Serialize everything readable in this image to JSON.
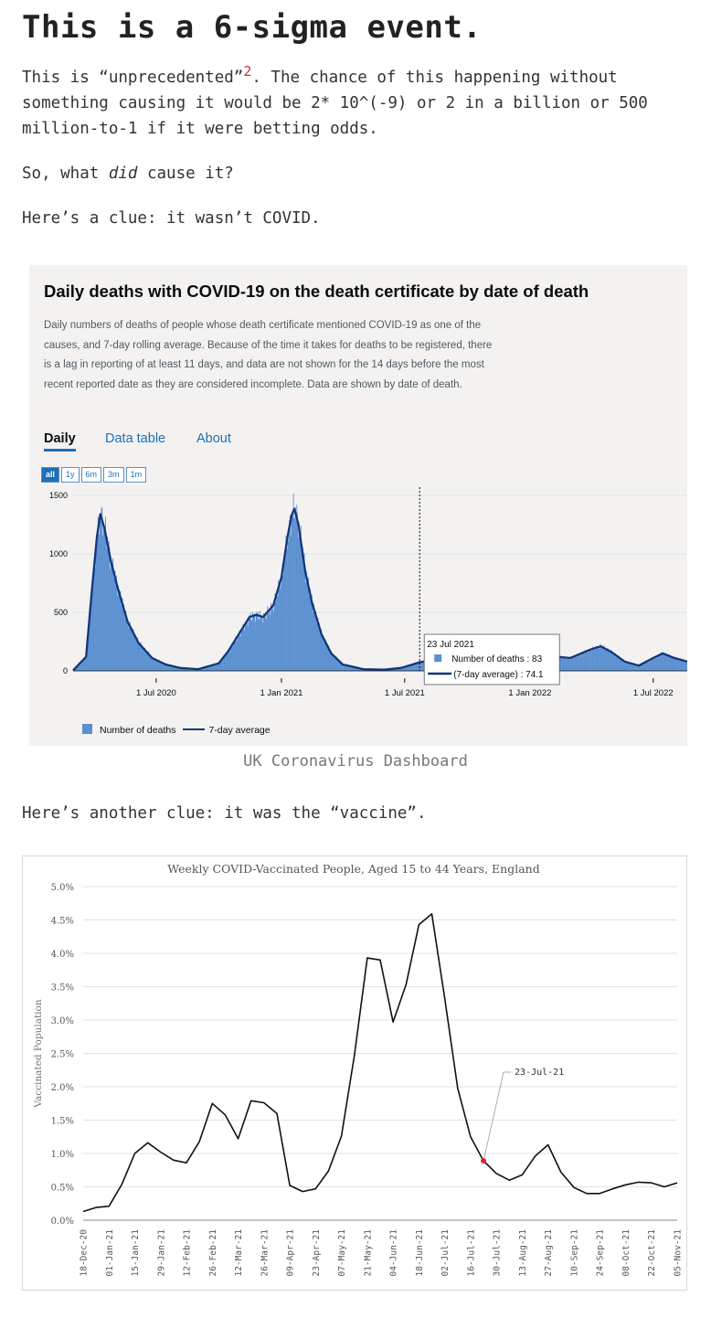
{
  "article": {
    "heading": "This is a 6-sigma event.",
    "p1_before": "This is “unprecedented”",
    "p1_footnote": "2",
    "p1_after": ". The chance of this happening without\nsomething causing it would be 2* 10^(-9) or 2 in a billion or 500\nmillion-to-1 if it were betting odds.",
    "p2_before": "So, what ",
    "p2_em": "did",
    "p2_after": " cause it?",
    "p3": "Here’s a clue: it wasn’t COVID.",
    "caption1": "UK Coronavirus Dashboard",
    "p4": "Here’s another clue: it was the “vaccine”."
  },
  "dashboard": {
    "title": "Daily deaths with COVID-19 on the death certificate by date of death",
    "description": "Daily numbers of deaths of people whose death certificate mentioned COVID-19 as one of the causes, and 7-day rolling average. Because of the time it takes for deaths to be registered, there is a lag in reporting of at least 11 days, and data are not shown for the 14 days before the most recent reported date as they are considered incomplete. Data are shown by date of death.",
    "tabs": [
      "Daily",
      "Data table",
      "About"
    ],
    "ranges": [
      "all",
      "1y",
      "6m",
      "3m",
      "1m"
    ],
    "legend": {
      "bars": "Number of deaths",
      "line": "7-day average"
    },
    "tooltip": {
      "date": "23 Jul 2021",
      "bars": "Number of deaths : 83",
      "line": "(7-day average) : 74.1"
    },
    "colors": {
      "bars": "#5a8fd0",
      "line": "#12367a",
      "tabs": "#1d70b8"
    }
  },
  "chart_data": [
    {
      "type": "bar",
      "title": "Daily deaths with COVID-19 on the death certificate by date of death",
      "x_range": [
        "2020-03-01",
        "2022-08-20"
      ],
      "xticks": [
        {
          "date": "2020-07-01",
          "label": "1 Jul 2020"
        },
        {
          "date": "2021-01-01",
          "label": "1 Jan 2021"
        },
        {
          "date": "2021-07-01",
          "label": "1 Jul 2021"
        },
        {
          "date": "2022-01-01",
          "label": "1 Jan 2022"
        },
        {
          "date": "2022-07-01",
          "label": "1 Jul 2022"
        }
      ],
      "yticks": [
        0,
        500,
        1000,
        1500
      ],
      "ylim": [
        0,
        1500
      ],
      "series": [
        {
          "name": "7-day average",
          "points": [
            [
              "2020-03-01",
              5
            ],
            [
              "2020-03-20",
              120
            ],
            [
              "2020-03-28",
              650
            ],
            [
              "2020-04-05",
              1150
            ],
            [
              "2020-04-10",
              1340
            ],
            [
              "2020-04-16",
              1220
            ],
            [
              "2020-04-25",
              950
            ],
            [
              "2020-05-05",
              720
            ],
            [
              "2020-05-20",
              420
            ],
            [
              "2020-06-05",
              240
            ],
            [
              "2020-06-25",
              110
            ],
            [
              "2020-07-15",
              55
            ],
            [
              "2020-08-05",
              25
            ],
            [
              "2020-09-01",
              15
            ],
            [
              "2020-10-01",
              65
            ],
            [
              "2020-10-15",
              170
            ],
            [
              "2020-11-01",
              330
            ],
            [
              "2020-11-15",
              460
            ],
            [
              "2020-11-25",
              480
            ],
            [
              "2020-12-05",
              460
            ],
            [
              "2020-12-20",
              560
            ],
            [
              "2021-01-01",
              800
            ],
            [
              "2021-01-10",
              1150
            ],
            [
              "2021-01-16",
              1330
            ],
            [
              "2021-01-20",
              1385
            ],
            [
              "2021-01-26",
              1250
            ],
            [
              "2021-02-05",
              850
            ],
            [
              "2021-02-15",
              580
            ],
            [
              "2021-03-01",
              310
            ],
            [
              "2021-03-15",
              150
            ],
            [
              "2021-04-01",
              55
            ],
            [
              "2021-05-01",
              15
            ],
            [
              "2021-06-01",
              10
            ],
            [
              "2021-06-25",
              25
            ],
            [
              "2021-07-10",
              50
            ],
            [
              "2021-07-23",
              74.1
            ],
            [
              "2021-08-10",
              90
            ],
            [
              "2021-09-01",
              100
            ],
            [
              "2021-10-01",
              110
            ],
            [
              "2021-11-01",
              125
            ],
            [
              "2021-11-20",
              110
            ],
            [
              "2021-12-10",
              95
            ],
            [
              "2022-01-01",
              145
            ],
            [
              "2022-01-15",
              180
            ],
            [
              "2022-02-01",
              125
            ],
            [
              "2022-03-01",
              110
            ],
            [
              "2022-04-01",
              185
            ],
            [
              "2022-04-15",
              210
            ],
            [
              "2022-05-01",
              160
            ],
            [
              "2022-05-20",
              80
            ],
            [
              "2022-06-10",
              45
            ],
            [
              "2022-07-01",
              110
            ],
            [
              "2022-07-15",
              150
            ],
            [
              "2022-08-01",
              110
            ],
            [
              "2022-08-20",
              80
            ]
          ]
        },
        {
          "name": "Number of deaths",
          "highlight": {
            "date": "2021-07-23",
            "value": 83
          }
        }
      ],
      "marker_date": "2021-07-23"
    },
    {
      "type": "line",
      "title": "Weekly COVID-Vaccinated People, Aged 15 to 44 Years, England",
      "ylabel": "Vaccinated Population",
      "xlabel": "",
      "ylim": [
        0,
        5
      ],
      "yticks": [
        "0.0%",
        "0.5%",
        "1.0%",
        "1.5%",
        "2.0%",
        "2.5%",
        "3.0%",
        "3.5%",
        "4.0%",
        "4.5%",
        "5.0%"
      ],
      "x": [
        "18-Dec-20",
        "25-Dec-20",
        "01-Jan-21",
        "08-Jan-21",
        "15-Jan-21",
        "22-Jan-21",
        "29-Jan-21",
        "05-Feb-21",
        "12-Feb-21",
        "19-Feb-21",
        "26-Feb-21",
        "05-Mar-21",
        "12-Mar-21",
        "19-Mar-21",
        "26-Mar-21",
        "02-Apr-21",
        "09-Apr-21",
        "16-Apr-21",
        "23-Apr-21",
        "30-Apr-21",
        "07-May-21",
        "14-May-21",
        "21-May-21",
        "28-May-21",
        "04-Jun-21",
        "11-Jun-21",
        "18-Jun-21",
        "25-Jun-21",
        "02-Jul-21",
        "09-Jul-21",
        "16-Jul-21",
        "23-Jul-21",
        "30-Jul-21",
        "06-Aug-21",
        "13-Aug-21",
        "20-Aug-21",
        "27-Aug-21",
        "03-Sep-21",
        "10-Sep-21",
        "17-Sep-21",
        "24-Sep-21",
        "01-Oct-21",
        "08-Oct-21",
        "15-Oct-21",
        "22-Oct-21",
        "29-Oct-21",
        "05-Nov-21"
      ],
      "values": [
        0.13,
        0.19,
        0.21,
        0.54,
        1.0,
        1.16,
        1.02,
        0.9,
        0.86,
        1.18,
        1.75,
        1.58,
        1.22,
        1.79,
        1.76,
        1.6,
        0.52,
        0.43,
        0.47,
        0.74,
        1.26,
        2.46,
        3.93,
        3.9,
        2.97,
        3.53,
        4.43,
        4.59,
        3.32,
        1.98,
        1.25,
        0.89,
        0.7,
        0.6,
        0.68,
        0.96,
        1.13,
        0.72,
        0.49,
        0.4,
        0.4,
        0.47,
        0.53,
        0.57,
        0.56,
        0.5,
        0.56
      ],
      "xtick_labels": [
        "18-Dec-20",
        "01-Jan-21",
        "15-Jan-21",
        "29-Jan-21",
        "12-Feb-21",
        "26-Feb-21",
        "12-Mar-21",
        "26-Mar-21",
        "09-Apr-21",
        "23-Apr-21",
        "07-May-21",
        "21-May-21",
        "04-Jun-21",
        "18-Jun-21",
        "02-Jul-21",
        "16-Jul-21",
        "30-Jul-21",
        "13-Aug-21",
        "27-Aug-21",
        "10-Sep-21",
        "24-Sep-21",
        "08-Oct-21",
        "22-Oct-21",
        "05-Nov-21"
      ],
      "annotation": {
        "x": "23-Jul-21",
        "label": "23-Jul-21"
      },
      "grid": true,
      "colors": {
        "line": "#111111",
        "marker": "#d62a2a",
        "grid": "#e2e2e2"
      }
    }
  ]
}
